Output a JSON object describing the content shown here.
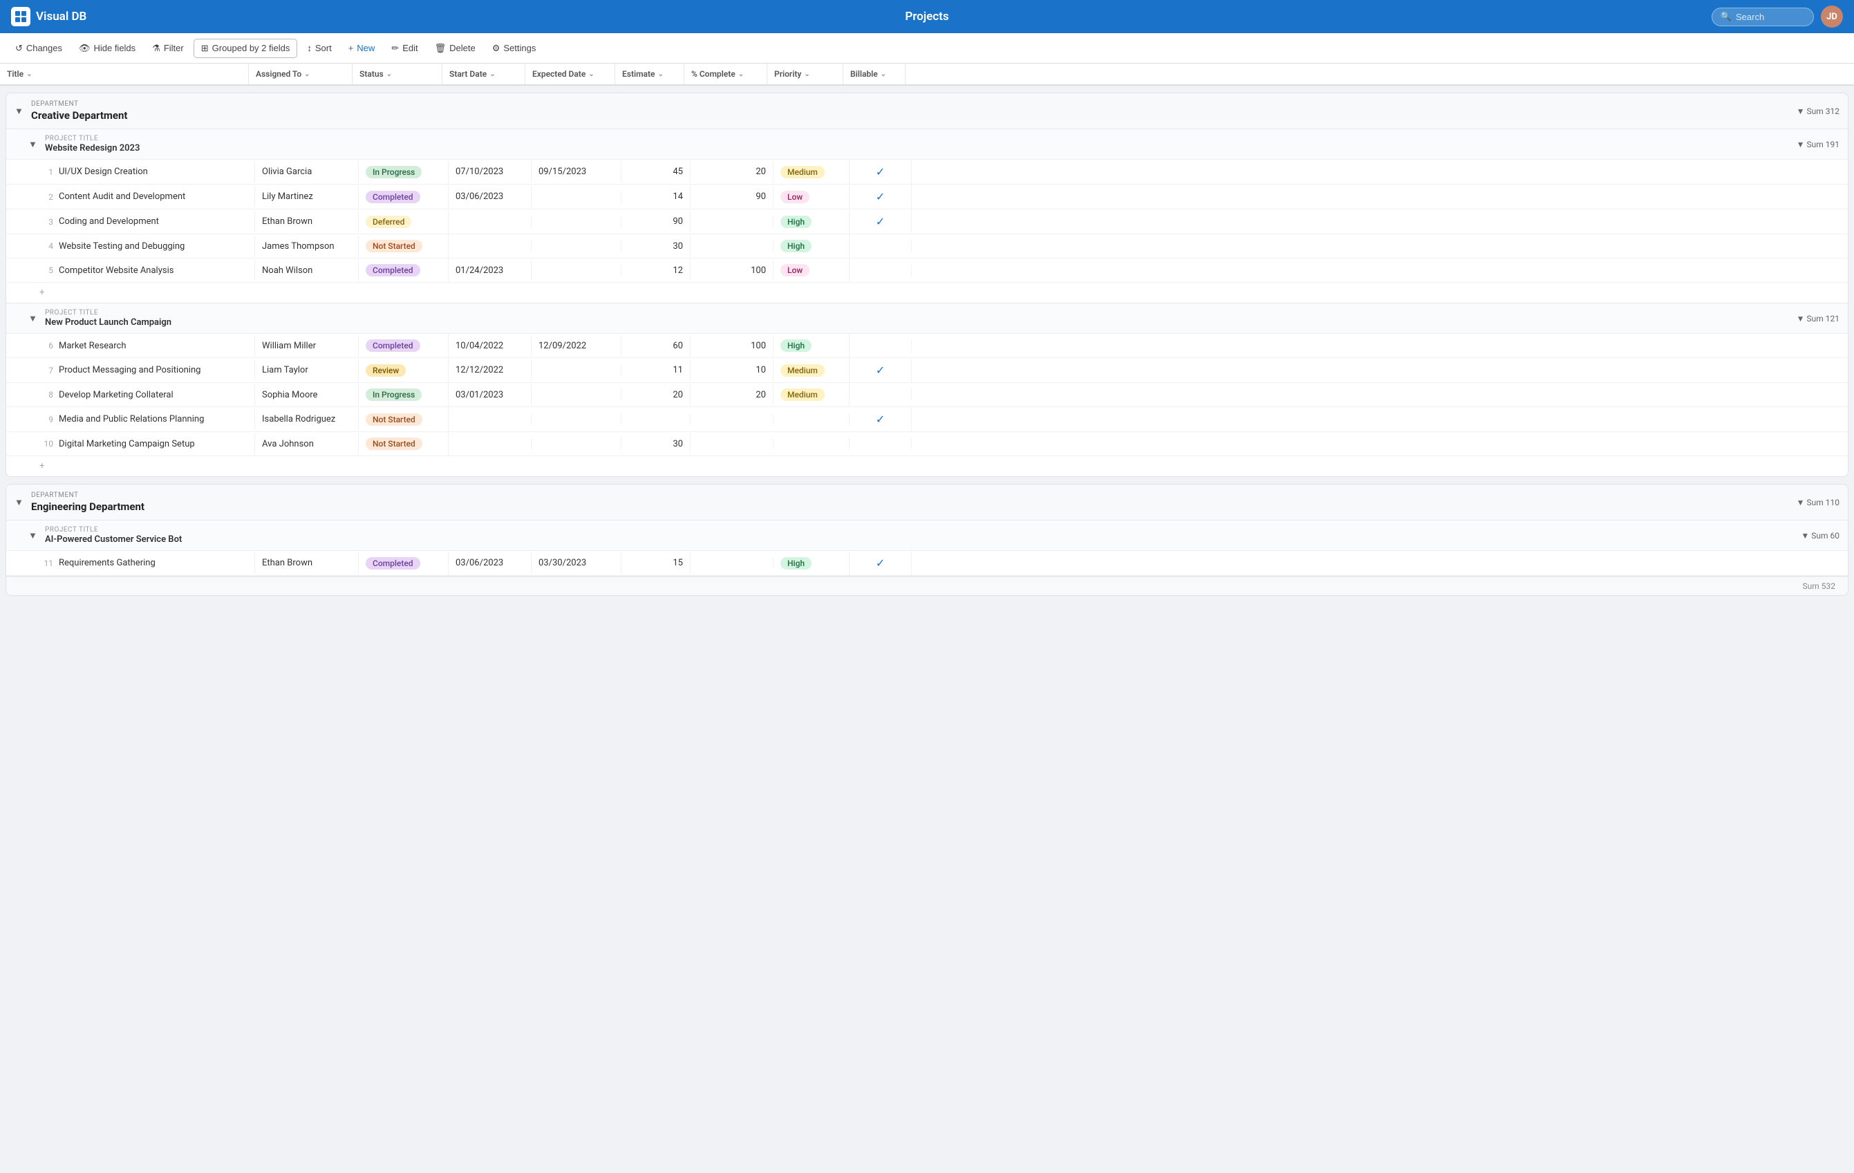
{
  "app": {
    "name": "Visual DB",
    "title": "Projects"
  },
  "search": {
    "placeholder": "Search"
  },
  "toolbar": {
    "changes": "Changes",
    "hide_fields": "Hide fields",
    "filter": "Filter",
    "grouped": "Grouped by 2 fields",
    "sort": "Sort",
    "new": "New",
    "edit": "Edit",
    "delete": "Delete",
    "settings": "Settings"
  },
  "columns": [
    {
      "key": "title",
      "label": "Title"
    },
    {
      "key": "assigned",
      "label": "Assigned To"
    },
    {
      "key": "status",
      "label": "Status"
    },
    {
      "key": "start",
      "label": "Start Date"
    },
    {
      "key": "expected",
      "label": "Expected Date"
    },
    {
      "key": "estimate",
      "label": "Estimate"
    },
    {
      "key": "complete",
      "label": "% Complete"
    },
    {
      "key": "priority",
      "label": "Priority"
    },
    {
      "key": "billable",
      "label": "Billable"
    }
  ],
  "departments": [
    {
      "name": "Creative Department",
      "sum": 312,
      "projects": [
        {
          "name": "Website Redesign 2023",
          "sum": 191,
          "tasks": [
            {
              "num": 1,
              "title": "UI/UX Design Creation",
              "assigned": "Olivia Garcia",
              "status": "In Progress",
              "status_type": "inprogress",
              "start": "07/10/2023",
              "expected": "09/15/2023",
              "estimate": 45,
              "complete": 20,
              "priority": "Medium",
              "priority_type": "medium",
              "billable": true
            },
            {
              "num": 2,
              "title": "Content Audit and Development",
              "assigned": "Lily Martinez",
              "status": "Completed",
              "status_type": "completed",
              "start": "03/06/2023",
              "expected": "",
              "estimate": 14,
              "complete": 90,
              "priority": "Low",
              "priority_type": "low",
              "billable": true
            },
            {
              "num": 3,
              "title": "Coding and Development",
              "assigned": "Ethan Brown",
              "status": "Deferred",
              "status_type": "deferred",
              "start": "",
              "expected": "",
              "estimate": 90,
              "complete": null,
              "priority": "High",
              "priority_type": "high",
              "billable": true
            },
            {
              "num": 4,
              "title": "Website Testing and Debugging",
              "assigned": "James Thompson",
              "status": "Not Started",
              "status_type": "notstarted",
              "start": "",
              "expected": "",
              "estimate": 30,
              "complete": null,
              "priority": "High",
              "priority_type": "high",
              "billable": false
            },
            {
              "num": 5,
              "title": "Competitor Website Analysis",
              "assigned": "Noah Wilson",
              "status": "Completed",
              "status_type": "completed",
              "start": "01/24/2023",
              "expected": "",
              "estimate": 12,
              "complete": 100,
              "priority": "Low",
              "priority_type": "low",
              "billable": false
            }
          ]
        },
        {
          "name": "New Product Launch Campaign",
          "sum": 121,
          "tasks": [
            {
              "num": 6,
              "title": "Market Research",
              "assigned": "William Miller",
              "status": "Completed",
              "status_type": "completed",
              "start": "10/04/2022",
              "expected": "12/09/2022",
              "estimate": 60,
              "complete": 100,
              "priority": "High",
              "priority_type": "high",
              "billable": false
            },
            {
              "num": 7,
              "title": "Product Messaging and Positioning",
              "assigned": "Liam Taylor",
              "status": "Review",
              "status_type": "review",
              "start": "12/12/2022",
              "expected": "",
              "estimate": 11,
              "complete": 10,
              "priority": "Medium",
              "priority_type": "medium",
              "billable": true
            },
            {
              "num": 8,
              "title": "Develop Marketing Collateral",
              "assigned": "Sophia Moore",
              "status": "In Progress",
              "status_type": "inprogress",
              "start": "03/01/2023",
              "expected": "",
              "estimate": 20,
              "complete": 20,
              "priority": "Medium",
              "priority_type": "medium",
              "billable": false
            },
            {
              "num": 9,
              "title": "Media and Public Relations Planning",
              "assigned": "Isabella Rodriguez",
              "status": "Not Started",
              "status_type": "notstarted",
              "start": "",
              "expected": "",
              "estimate": null,
              "complete": null,
              "priority": "",
              "priority_type": "",
              "billable": true
            },
            {
              "num": 10,
              "title": "Digital Marketing Campaign Setup",
              "assigned": "Ava Johnson",
              "status": "Not Started",
              "status_type": "notstarted",
              "start": "",
              "expected": "",
              "estimate": 30,
              "complete": null,
              "priority": "",
              "priority_type": "",
              "billable": false
            }
          ]
        }
      ]
    },
    {
      "name": "Engineering Department",
      "sum": 110,
      "projects": [
        {
          "name": "AI-Powered Customer Service Bot",
          "sum": 60,
          "tasks": [
            {
              "num": 11,
              "title": "Requirements Gathering",
              "assigned": "Ethan Brown",
              "status": "Completed",
              "status_type": "completed",
              "start": "03/06/2023",
              "expected": "03/30/2023",
              "estimate": 15,
              "complete": null,
              "priority": "High",
              "priority_type": "high",
              "billable": true
            }
          ]
        }
      ]
    }
  ],
  "footer_sum": "Sum 532",
  "labels": {
    "dept_label": "DEPARTMENT",
    "proj_label": "PROJECT TITLE",
    "sum_prefix": "▼ Sum",
    "add_row": "+",
    "check": "✓"
  }
}
